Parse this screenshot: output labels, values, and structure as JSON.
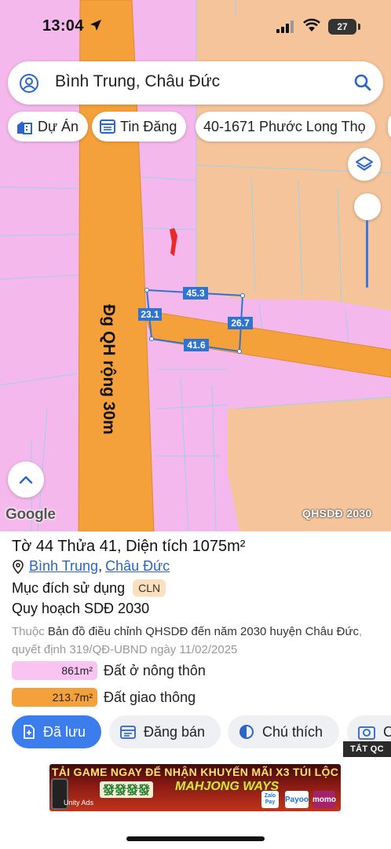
{
  "status_bar": {
    "time": "13:04",
    "battery": "27"
  },
  "search": {
    "query": "Bình Trung, Châu Đức"
  },
  "chips": [
    {
      "label": "Dự Án",
      "icon": "building-icon"
    },
    {
      "label": "Tin Đăng",
      "icon": "listing-icon"
    },
    {
      "label": "40-1671 Phước Long Thọ"
    }
  ],
  "map": {
    "road_label": "Đg QH rộng 30m",
    "dimensions": {
      "top": "45.3",
      "left": "23.1",
      "right": "26.7",
      "bottom": "41.6"
    },
    "google_logo": "Google",
    "badge": "QHSDĐ 2030",
    "colors": {
      "residential": "#f5b8ec",
      "transport": "#f5a13b",
      "agriculture": "#f5c49a"
    }
  },
  "parcel": {
    "title": "Tờ 44 Thửa 41, Diện tích 1075m²",
    "location_ward": "Bình Trung",
    "location_separator": ",",
    "location_district": "Châu Đức",
    "purpose_label": "Mục đích sử dụng",
    "purpose_code": "CLN",
    "plan_title": "Quy hoạch SDĐ 2030",
    "desc_prefix": "Thuộc",
    "desc_main": "Bản đồ điều chỉnh QHSDĐ đến năm 2030 huyện Châu Đức",
    "desc_suffix": ", quyết định 319/QĐ-UBND ngày 11/02/2025",
    "legend": [
      {
        "area": "861m²",
        "label": "Đất ở nông thôn",
        "color": "#f9c4f1"
      },
      {
        "area": "213.7m²",
        "label": "Đất giao thông",
        "color": "#f5a13b"
      }
    ]
  },
  "actions": {
    "saved": "Đã lưu",
    "post": "Đăng bán",
    "legend": "Chú thích",
    "more": "C"
  },
  "ad": {
    "close_label": "TẮT QC",
    "headline": "TẢI GAME NGAY ĐỂ NHẬN KHUYẾN MÃI X3 TÚI LỘC",
    "tiles": "發發發發",
    "logo": "MAHJONG WAYS",
    "unity": "Unity Ads",
    "zalo": "Zalo Pay",
    "payoo": "Payoo",
    "momo": "momo"
  }
}
